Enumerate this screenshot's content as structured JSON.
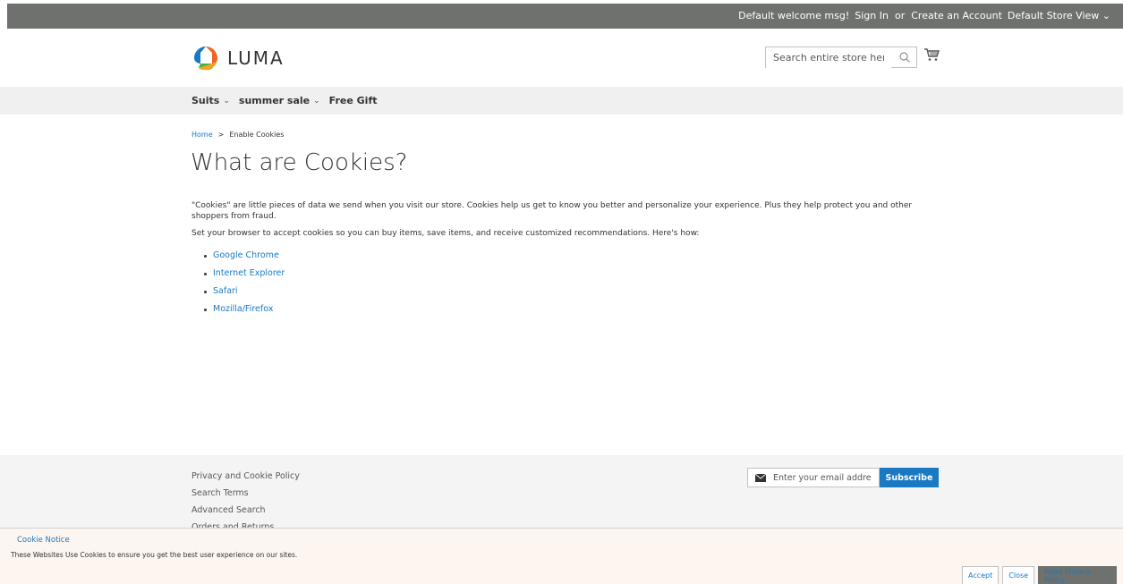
{
  "topbar": {
    "welcome": "Default welcome msg!",
    "sign_in": "Sign In",
    "or": "or",
    "create_account": "Create an Account",
    "store_view": "Default Store View"
  },
  "header": {
    "logo_text": "LUMA",
    "search_placeholder": "Search entire store here...",
    "search_value": ""
  },
  "nav": {
    "items": [
      {
        "label": "Suits",
        "has_dropdown": true
      },
      {
        "label": "summer sale",
        "has_dropdown": true
      },
      {
        "label": "Free Gift",
        "has_dropdown": false
      }
    ]
  },
  "breadcrumb": {
    "home": "Home",
    "separator": ">",
    "current": "Enable Cookies"
  },
  "page": {
    "title": "What are Cookies?",
    "para1": "\"Cookies\" are little pieces of data we send when you visit our store. Cookies help us get to know you better and personalize your experience. Plus they help protect you and other shoppers from fraud.",
    "para2": "Set your browser to accept cookies so you can buy items, save items, and receive customized recommendations. Here's how:",
    "browsers": [
      "Google Chrome",
      "Internet Explorer",
      "Safari",
      "Mozilla/Firefox"
    ]
  },
  "footer": {
    "links": [
      "Privacy and Cookie Policy",
      "Search Terms",
      "Advanced Search",
      "Orders and Returns"
    ],
    "email_placeholder": "Enter your email address",
    "subscribe_label": "Subscribe"
  },
  "cookie_notice": {
    "title": "Cookie Notice",
    "text": "These Websites Use Cookies to ensure you get the best user experience on our sites.",
    "accept_label": "Accept",
    "close_label": "Close",
    "policy_label": "Read Privacy Policy"
  },
  "colors": {
    "topbar_bg": "#6e716e",
    "link": "#1979c3",
    "nav_bg": "#f0f0f0",
    "footer_bg": "#f4f4f4",
    "cookie_bg": "#fdf5f0"
  }
}
